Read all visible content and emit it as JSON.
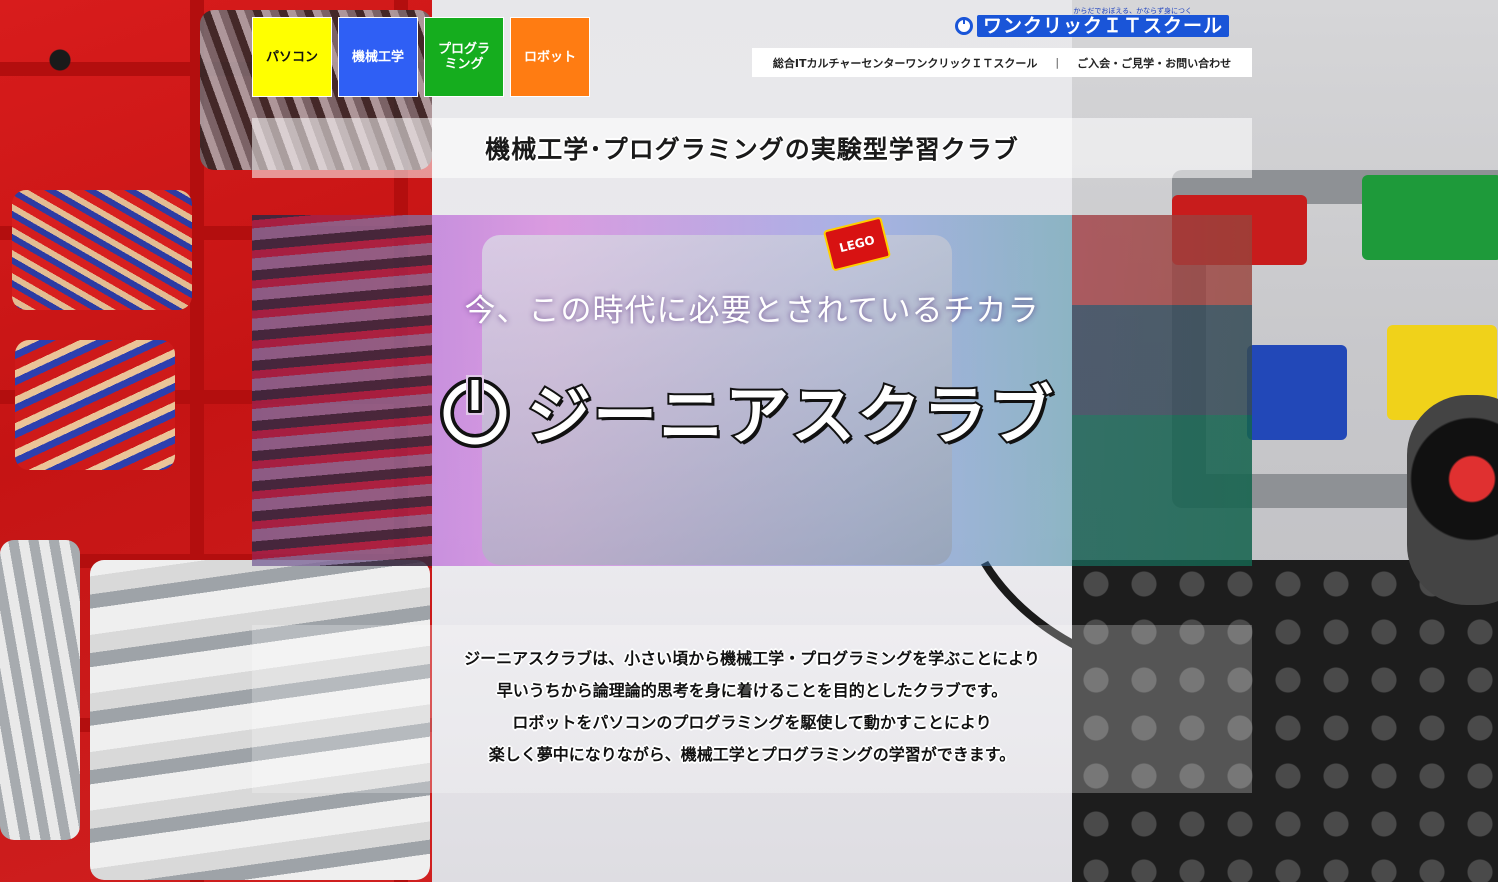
{
  "nav": {
    "items": [
      {
        "label": "パソコン",
        "color": "#ffff00"
      },
      {
        "label": "機械工学",
        "color": "#2f5ff5"
      },
      {
        "label": "プログラ\nミング",
        "color": "#15ad1e"
      },
      {
        "label": "ロボット",
        "color": "#ff7c12"
      }
    ]
  },
  "brand": {
    "tagline": "からだでおぼえる、かならず身につく",
    "name": "ワンクリックＩＴスクール",
    "color": "#1a55d8"
  },
  "topbar": {
    "center_name": "総合ITカルチャーセンターワンクリックＩＴスクール",
    "separator": "|",
    "contact_link": "ご入会・ご見学・お問い合わせ"
  },
  "headline": {
    "title": "機械工学･プログラミングの実験型学習クラブ"
  },
  "hero": {
    "tagline": "今、この時代に必要とされているチカラ",
    "club_name": "ジーニアスクラブ",
    "lego_label": "LEGO"
  },
  "description": {
    "lines": [
      "ジーニアスクラブは、小さい頃から機械工学・プログラミングを学ぶことにより",
      "早いうちから論理論的思考を身に着けることを目的としたクラブです。",
      "ロボットをパソコンのプログラミングを駆使して動かすことにより",
      "楽しく夢中になりながら、機械工学とプログラミングの学習ができます。"
    ]
  }
}
